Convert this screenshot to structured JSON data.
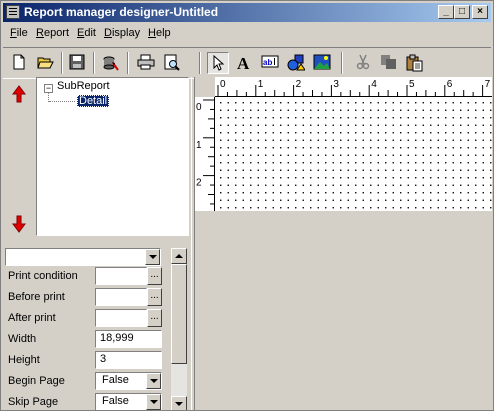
{
  "window": {
    "title": "Report manager designer-Untitled",
    "controls": [
      "_",
      "□",
      "×"
    ]
  },
  "menu": {
    "items": [
      {
        "label": "File",
        "u": "F",
        "rest": "ile"
      },
      {
        "label": "Report",
        "u": "R",
        "rest": "eport"
      },
      {
        "label": "Edit",
        "u": "E",
        "rest": "dit"
      },
      {
        "label": "Display",
        "u": "D",
        "rest": "isplay"
      },
      {
        "label": "Help",
        "u": "H",
        "rest": "elp"
      }
    ]
  },
  "toolbar": {
    "icons": [
      "new-document-icon",
      "open-folder-icon",
      "save-icon",
      "data-config-icon",
      "print-icon",
      "print-preview-icon",
      "select-pointer-icon",
      "text-label-icon",
      "expression-field-icon",
      "shape-icon",
      "image-icon",
      "cut-icon",
      "copy-icon",
      "paste-icon"
    ]
  },
  "tree": {
    "root": "SubReport",
    "expander": "−",
    "child": "Detail",
    "selected": "Detail"
  },
  "properties": {
    "selector_value": "",
    "rows": [
      {
        "label": "Print condition",
        "value": "",
        "kind": "ellipsis"
      },
      {
        "label": "Before print",
        "value": "",
        "kind": "ellipsis"
      },
      {
        "label": "After print",
        "value": "",
        "kind": "ellipsis"
      },
      {
        "label": "Width",
        "value": "18,999",
        "kind": "text"
      },
      {
        "label": "Height",
        "value": "3",
        "kind": "text"
      },
      {
        "label": "Begin Page",
        "value": "False",
        "kind": "combo"
      },
      {
        "label": "Skip Page",
        "value": "False",
        "kind": "combo"
      }
    ],
    "ellipsis_label": "..."
  },
  "ruler": {
    "horizontal_labels": [
      "0",
      "1",
      "2",
      "3",
      "4",
      "5",
      "6",
      "7"
    ],
    "vertical_labels": [
      "0",
      "1",
      "2"
    ]
  },
  "colors": {
    "title_start": "#0a246a",
    "title_end": "#a6caf0",
    "selection": "#0a246a",
    "arrow_red": "#e00000",
    "face": "#d4d0c8"
  }
}
